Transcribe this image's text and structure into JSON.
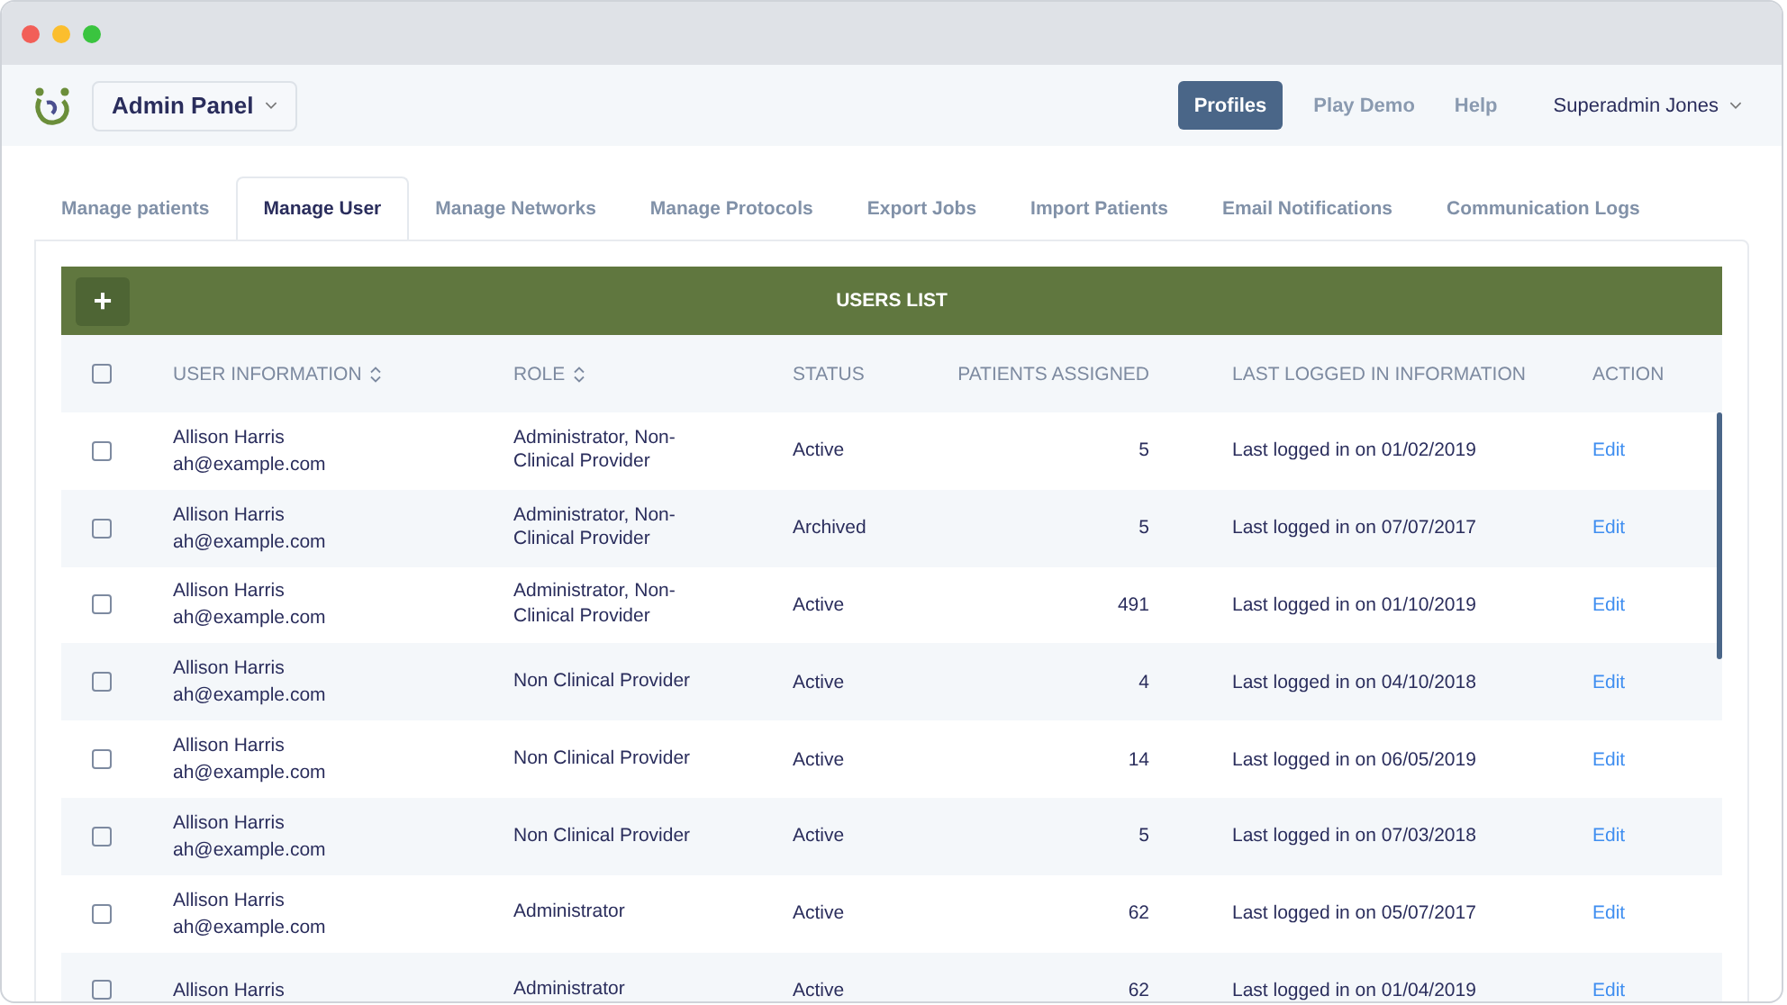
{
  "header": {
    "panel": "Admin Panel",
    "nav": [
      {
        "label": "Profiles",
        "selected": true
      },
      {
        "label": "Play Demo",
        "selected": false
      },
      {
        "label": "Help",
        "selected": false
      }
    ],
    "user": "Superadmin Jones"
  },
  "tabs": [
    {
      "label": "Manage patients",
      "selected": false
    },
    {
      "label": "Manage User",
      "selected": true
    },
    {
      "label": "Manage Networks",
      "selected": false
    },
    {
      "label": "Manage Protocols",
      "selected": false
    },
    {
      "label": "Export Jobs",
      "selected": false
    },
    {
      "label": "Import Patients",
      "selected": false
    },
    {
      "label": "Email Notifications",
      "selected": false
    },
    {
      "label": "Communication Logs",
      "selected": false
    }
  ],
  "table": {
    "title": "USERS LIST",
    "add_button": "+",
    "select_all_checked": false,
    "columns": [
      {
        "label": "USER INFORMATION",
        "sortable": true
      },
      {
        "label": "ROLE",
        "sortable": true
      },
      {
        "label": "STATUS",
        "sortable": false
      },
      {
        "label": "PATIENTS ASSIGNED",
        "sortable": false
      },
      {
        "label": "LAST LOGGED IN INFORMATION",
        "sortable": false
      },
      {
        "label": "ACTION",
        "sortable": false
      }
    ],
    "rows": [
      {
        "checked": false,
        "name": "Allison Harris",
        "email": "ah@example.com",
        "role": "Administrator, Non-Clinical Provider",
        "status": "Active",
        "patients": "5",
        "last_login": "Last logged in on 01/02/2019",
        "action": "Edit"
      },
      {
        "checked": false,
        "name": "Allison Harris",
        "email": "ah@example.com",
        "role": "Administrator, Non-Clinical Provider",
        "status": "Archived",
        "patients": "5",
        "last_login": "Last logged in on 07/07/2017",
        "action": "Edit"
      },
      {
        "checked": false,
        "name": "Allison Harris",
        "email": "ah@example.com",
        "role": "Administrator, Non-Clinical Provider",
        "status": "Active",
        "patients": "491",
        "last_login": "Last logged in on 01/10/2019",
        "action": "Edit"
      },
      {
        "checked": false,
        "name": "Allison Harris",
        "email": "ah@example.com",
        "role": "Non Clinical Provider",
        "status": "Active",
        "patients": "4",
        "last_login": "Last logged in on 04/10/2018",
        "action": "Edit"
      },
      {
        "checked": false,
        "name": "Allison Harris",
        "email": "ah@example.com",
        "role": "Non Clinical Provider",
        "status": "Active",
        "patients": "14",
        "last_login": "Last logged in on 06/05/2019",
        "action": "Edit"
      },
      {
        "checked": false,
        "name": "Allison Harris",
        "email": "ah@example.com",
        "role": "Non Clinical Provider",
        "status": "Active",
        "patients": "5",
        "last_login": "Last logged in on 07/03/2018",
        "action": "Edit"
      },
      {
        "checked": false,
        "name": "Allison Harris",
        "email": "ah@example.com",
        "role": "Administrator",
        "status": "Active",
        "patients": "62",
        "last_login": "Last logged in on 05/07/2017",
        "action": "Edit"
      },
      {
        "checked": false,
        "name": "Allison Harris",
        "role": "Administrator",
        "status": "Active",
        "patients": "62",
        "last_login": "Last logged in on 01/04/2019",
        "action": "Edit"
      }
    ]
  }
}
